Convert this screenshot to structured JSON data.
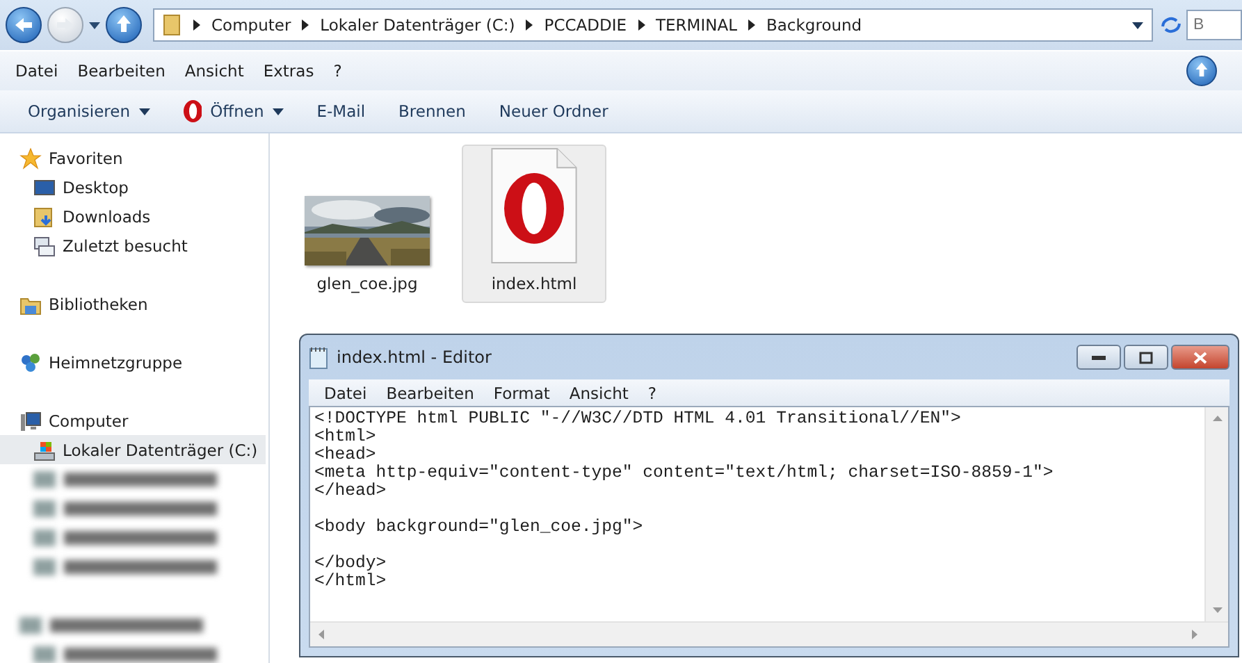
{
  "nav_buttons": [
    {
      "kind": "back",
      "disabled": false
    },
    {
      "kind": "forward",
      "disabled": true
    }
  ],
  "address": [
    "Computer",
    "Lokaler Datenträger (C:)",
    "PCCADDIE",
    "TERMINAL",
    "Background"
  ],
  "search": {
    "placeholder": "B"
  },
  "menu": [
    "Datei",
    "Bearbeiten",
    "Ansicht",
    "Extras",
    "?"
  ],
  "toolbar": [
    {
      "label": "Organisieren",
      "kind": "text",
      "dropdown": true
    },
    {
      "label": "Öffnen",
      "kind": "opera",
      "dropdown": true
    },
    {
      "label": "E-Mail",
      "kind": "text",
      "dropdown": false
    },
    {
      "label": "Brennen",
      "kind": "text",
      "dropdown": false
    },
    {
      "label": "Neuer Ordner",
      "kind": "text",
      "dropdown": false
    }
  ],
  "sidebar": [
    {
      "label": "Favoriten",
      "kind": "star",
      "selected": false,
      "children": [
        {
          "label": "Desktop",
          "kind": "desktop",
          "selected": false
        },
        {
          "label": "Downloads",
          "kind": "downloads",
          "selected": false
        },
        {
          "label": "Zuletzt besucht",
          "kind": "recent",
          "selected": false
        }
      ]
    },
    {
      "label": "Bibliotheken",
      "kind": "library",
      "selected": false
    },
    {
      "label": "Heimnetzgruppe",
      "kind": "homegroup",
      "selected": false
    },
    {
      "label": "Computer",
      "kind": "computer",
      "selected": false,
      "children": [
        {
          "label": "Lokaler Datenträger (C:)",
          "kind": "drive",
          "selected": true
        },
        {
          "kind": "blurred",
          "selected": false
        },
        {
          "kind": "blurred",
          "selected": false
        },
        {
          "kind": "blurred",
          "selected": false
        },
        {
          "kind": "blurred",
          "selected": false
        }
      ]
    },
    {
      "kind": "blurred",
      "selected": false,
      "children": [
        {
          "kind": "blurred",
          "selected": false
        }
      ]
    }
  ],
  "files": [
    {
      "name": "glen_coe.jpg",
      "kind": "picture",
      "selected": false
    },
    {
      "name": "index.html",
      "kind": "opera",
      "selected": true
    }
  ],
  "editor": {
    "title": "index.html - Editor",
    "menu": [
      "Datei",
      "Bearbeiten",
      "Format",
      "Ansicht",
      "?"
    ],
    "blocks": [
      [
        "<!DOCTYPE html PUBLIC \"-//W3C//DTD HTML 4.01 Transitional//EN\">",
        "<html>",
        "<head>",
        "<meta http-equiv=\"content-type\" content=\"text/html; charset=ISO-8859-1\">",
        "</head>"
      ],
      [
        "<body background=\"glen_coe.jpg\">"
      ],
      [
        "</body>",
        "</html>"
      ]
    ]
  }
}
